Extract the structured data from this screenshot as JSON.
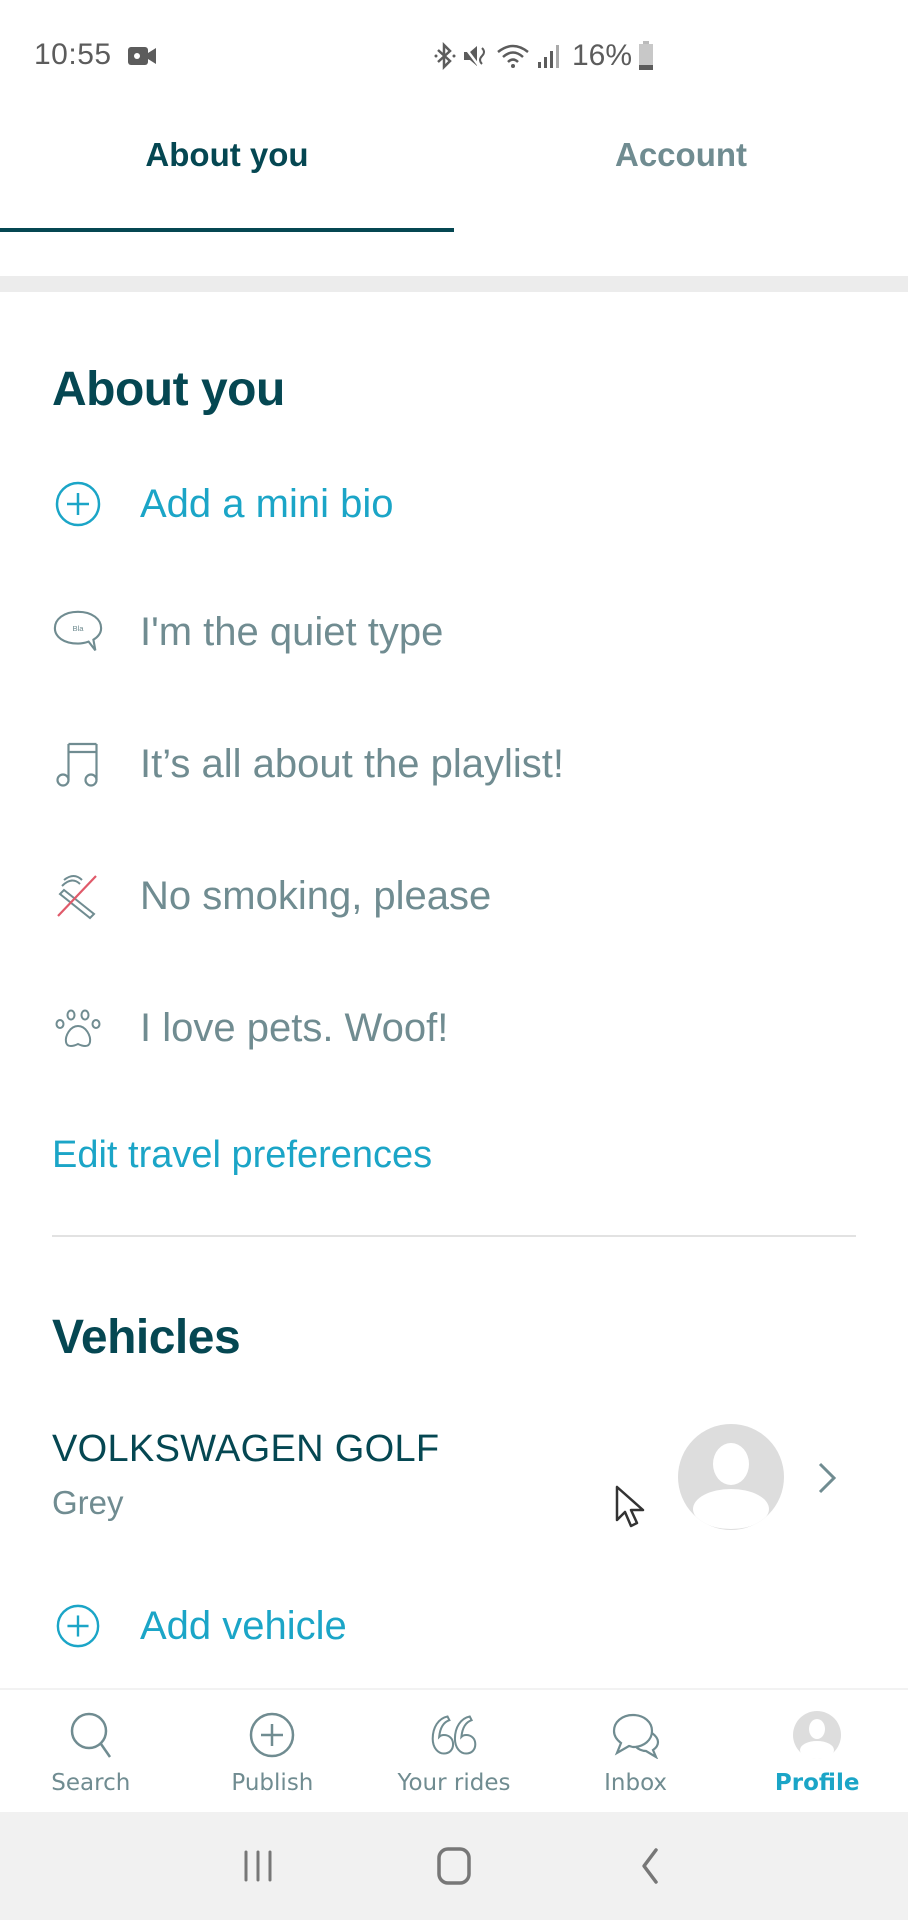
{
  "status_bar": {
    "time": "10:55",
    "battery": "16%",
    "icons": [
      "video-record-icon",
      "bluetooth-icon",
      "mute-icon",
      "wifi-icon",
      "signal-icon",
      "battery-icon"
    ]
  },
  "tabs": [
    {
      "label": "About you",
      "active": true
    },
    {
      "label": "Account",
      "active": false
    }
  ],
  "about": {
    "title": "About you",
    "add_bio": {
      "label": "Add a mini bio",
      "icon": "plus-circle-icon"
    },
    "preferences": [
      {
        "label": "I'm the quiet type",
        "icon": "chat-bubble-icon",
        "icon_text": "Bla"
      },
      {
        "label": "It’s all about the playlist!",
        "icon": "music-note-icon"
      },
      {
        "label": "No smoking, please",
        "icon": "no-smoking-icon"
      },
      {
        "label": "I love pets. Woof!",
        "icon": "paw-icon"
      }
    ],
    "edit_link": "Edit travel preferences"
  },
  "vehicles": {
    "title": "Vehicles",
    "items": [
      {
        "name": "VOLKSWAGEN GOLF",
        "color": "Grey"
      }
    ],
    "add_label": "Add vehicle"
  },
  "bottom_nav": [
    {
      "label": "Search",
      "icon": "search-icon",
      "active": false
    },
    {
      "label": "Publish",
      "icon": "plus-circle-icon",
      "active": false
    },
    {
      "label": "Your rides",
      "icon": "quote-icon",
      "active": false
    },
    {
      "label": "Inbox",
      "icon": "chat-icon",
      "active": false
    },
    {
      "label": "Profile",
      "icon": "avatar-icon",
      "active": true
    }
  ],
  "colors": {
    "primary_dark": "#054752",
    "secondary_text": "#708c91",
    "accent": "#1ba5c7",
    "no_smoking_red": "#e05a6a"
  }
}
